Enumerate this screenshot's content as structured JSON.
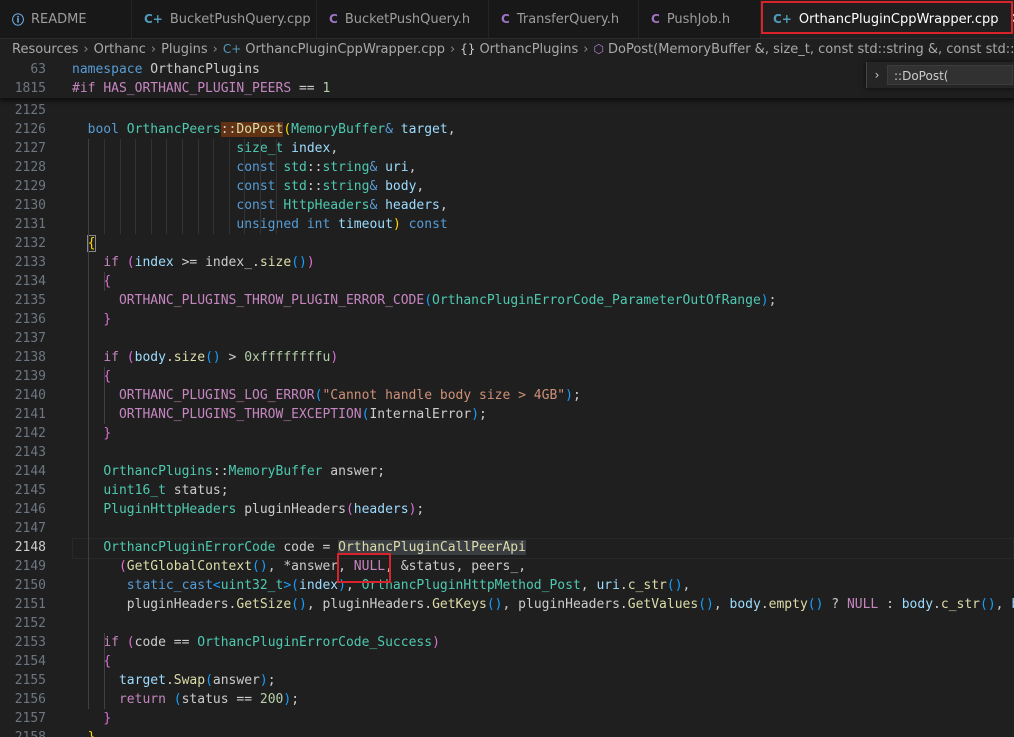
{
  "tabs": [
    {
      "icon": "info-icon",
      "glyph": "ⓘ",
      "label": "README",
      "kind": "info"
    },
    {
      "icon": "cpp-file-icon",
      "glyph": "C+",
      "label": "BucketPushQuery.cpp",
      "kind": "cpp"
    },
    {
      "icon": "c-header-icon",
      "glyph": "C",
      "label": "BucketPushQuery.h",
      "kind": "h"
    },
    {
      "icon": "c-header-icon",
      "glyph": "C",
      "label": "TransferQuery.h",
      "kind": "h"
    },
    {
      "icon": "c-header-icon",
      "glyph": "C",
      "label": "PushJob.h",
      "kind": "h"
    },
    {
      "icon": "cpp-file-icon",
      "glyph": "C+",
      "label": "OrthancPluginCppWrapper.cpp",
      "kind": "cpp",
      "active": true,
      "close": "✕"
    }
  ],
  "breadcrumb": {
    "items": [
      "Resources",
      "Orthanc",
      "Plugins",
      "OrthancPluginCppWrapper.cpp",
      "OrthancPlugins",
      "DoPost(MemoryBuffer &, size_t, const std::string &, const std::string &, const H"
    ],
    "sep": "›",
    "file_glyph": "C+",
    "ns_glyph": "{}",
    "method_glyph": "⬡"
  },
  "find": {
    "chevron": "›",
    "value": "::DoPost("
  },
  "sticky": [
    {
      "num": "63",
      "tokens": [
        [
          "kw",
          "namespace"
        ],
        [
          "",
          " OrthancPlugins"
        ]
      ]
    },
    {
      "num": "1815",
      "tokens": [
        [
          "pp",
          "#if"
        ],
        [
          "",
          " "
        ],
        [
          "mac",
          "HAS_ORTHANC_PLUGIN_PEERS"
        ],
        [
          "",
          " == "
        ],
        [
          "nu",
          "1"
        ]
      ]
    }
  ],
  "lines": [
    {
      "num": "2125",
      "tokens": []
    },
    {
      "num": "2126",
      "tokens": [
        [
          "",
          "  "
        ],
        [
          "kw",
          "bool"
        ],
        [
          "",
          " "
        ],
        [
          "cl",
          "OrthancPeers"
        ],
        [
          "hl",
          "::"
        ],
        [
          "hlfn",
          "DoPost"
        ],
        [
          "b1",
          "("
        ],
        [
          "ty",
          "MemoryBuffer"
        ],
        [
          "kw",
          "&"
        ],
        [
          "",
          " "
        ],
        [
          "pa",
          "target"
        ],
        [
          "",
          ","
        ]
      ]
    },
    {
      "num": "2127",
      "tokens": [
        [
          "",
          "                     "
        ],
        [
          "ty",
          "size_t"
        ],
        [
          "",
          " "
        ],
        [
          "pa",
          "index"
        ],
        [
          "",
          ","
        ]
      ]
    },
    {
      "num": "2128",
      "tokens": [
        [
          "",
          "                     "
        ],
        [
          "kw",
          "const"
        ],
        [
          "",
          " "
        ],
        [
          "ty",
          "std"
        ],
        [
          "",
          "::"
        ],
        [
          "ty",
          "string"
        ],
        [
          "kw",
          "&"
        ],
        [
          "",
          " "
        ],
        [
          "pa",
          "uri"
        ],
        [
          "",
          ","
        ]
      ]
    },
    {
      "num": "2129",
      "tokens": [
        [
          "",
          "                     "
        ],
        [
          "kw",
          "const"
        ],
        [
          "",
          " "
        ],
        [
          "ty",
          "std"
        ],
        [
          "",
          "::"
        ],
        [
          "ty",
          "string"
        ],
        [
          "kw",
          "&"
        ],
        [
          "",
          " "
        ],
        [
          "pa",
          "body"
        ],
        [
          "",
          ","
        ]
      ]
    },
    {
      "num": "2130",
      "tokens": [
        [
          "",
          "                     "
        ],
        [
          "kw",
          "const"
        ],
        [
          "",
          " "
        ],
        [
          "ty",
          "HttpHeaders"
        ],
        [
          "kw",
          "&"
        ],
        [
          "",
          " "
        ],
        [
          "pa",
          "headers"
        ],
        [
          "",
          ","
        ]
      ]
    },
    {
      "num": "2131",
      "tokens": [
        [
          "",
          "                     "
        ],
        [
          "kw",
          "unsigned"
        ],
        [
          "",
          " "
        ],
        [
          "kw",
          "int"
        ],
        [
          "",
          " "
        ],
        [
          "pa",
          "timeout"
        ],
        [
          "b1",
          ")"
        ],
        [
          "",
          " "
        ],
        [
          "kw",
          "const"
        ]
      ]
    },
    {
      "num": "2132",
      "tokens": [
        [
          "",
          "  "
        ],
        [
          "b1hl",
          "{"
        ]
      ]
    },
    {
      "num": "2133",
      "tokens": [
        [
          "",
          "    "
        ],
        [
          "pp",
          "if"
        ],
        [
          "",
          " "
        ],
        [
          "b2",
          "("
        ],
        [
          "pa",
          "index"
        ],
        [
          "",
          " >= "
        ],
        [
          "",
          "index_"
        ],
        [
          "",
          "."
        ],
        [
          "fn",
          "size"
        ],
        [
          "b3",
          "()"
        ],
        [
          "b2",
          ")"
        ]
      ]
    },
    {
      "num": "2134",
      "tokens": [
        [
          "",
          "    "
        ],
        [
          "b2",
          "{"
        ]
      ]
    },
    {
      "num": "2135",
      "tokens": [
        [
          "",
          "      "
        ],
        [
          "mac",
          "ORTHANC_PLUGINS_THROW_PLUGIN_ERROR_CODE"
        ],
        [
          "b3",
          "("
        ],
        [
          "ty",
          "OrthancPluginErrorCode_ParameterOutOfRange"
        ],
        [
          "b3",
          ")"
        ],
        [
          "",
          ";"
        ]
      ]
    },
    {
      "num": "2136",
      "tokens": [
        [
          "",
          "    "
        ],
        [
          "b2",
          "}"
        ]
      ]
    },
    {
      "num": "2137",
      "tokens": []
    },
    {
      "num": "2138",
      "tokens": [
        [
          "",
          "    "
        ],
        [
          "pp",
          "if"
        ],
        [
          "",
          " "
        ],
        [
          "b2",
          "("
        ],
        [
          "pa",
          "body"
        ],
        [
          "",
          "."
        ],
        [
          "fn",
          "size"
        ],
        [
          "b3",
          "()"
        ],
        [
          "",
          " > "
        ],
        [
          "nu",
          "0xffffffffu"
        ],
        [
          "b2",
          ")"
        ]
      ]
    },
    {
      "num": "2139",
      "tokens": [
        [
          "",
          "    "
        ],
        [
          "b2",
          "{"
        ]
      ]
    },
    {
      "num": "2140",
      "tokens": [
        [
          "",
          "      "
        ],
        [
          "mac",
          "ORTHANC_PLUGINS_LOG_ERROR"
        ],
        [
          "b3",
          "("
        ],
        [
          "st",
          "\"Cannot handle body size > 4GB\""
        ],
        [
          "b3",
          ")"
        ],
        [
          "",
          ";"
        ]
      ]
    },
    {
      "num": "2141",
      "tokens": [
        [
          "",
          "      "
        ],
        [
          "mac",
          "ORTHANC_PLUGINS_THROW_EXCEPTION"
        ],
        [
          "b3",
          "("
        ],
        [
          "",
          "InternalError"
        ],
        [
          "b3",
          ")"
        ],
        [
          "",
          ";"
        ]
      ]
    },
    {
      "num": "2142",
      "tokens": [
        [
          "",
          "    "
        ],
        [
          "b2",
          "}"
        ]
      ]
    },
    {
      "num": "2143",
      "tokens": []
    },
    {
      "num": "2144",
      "tokens": [
        [
          "",
          "    "
        ],
        [
          "ty",
          "OrthancPlugins"
        ],
        [
          "",
          "::"
        ],
        [
          "ty",
          "MemoryBuffer"
        ],
        [
          "",
          " "
        ],
        [
          "",
          "answer"
        ],
        [
          "",
          ";"
        ]
      ]
    },
    {
      "num": "2145",
      "tokens": [
        [
          "",
          "    "
        ],
        [
          "ty",
          "uint16_t"
        ],
        [
          "",
          " "
        ],
        [
          "",
          "status"
        ],
        [
          "",
          ";"
        ]
      ]
    },
    {
      "num": "2146",
      "tokens": [
        [
          "",
          "    "
        ],
        [
          "ty",
          "PluginHttpHeaders"
        ],
        [
          "",
          " "
        ],
        [
          "",
          "pluginHeaders"
        ],
        [
          "b2",
          "("
        ],
        [
          "pa",
          "headers"
        ],
        [
          "b2",
          ")"
        ],
        [
          "",
          ";"
        ]
      ]
    },
    {
      "num": "2147",
      "tokens": []
    },
    {
      "num": "2148",
      "tokens": [
        [
          "",
          "    "
        ],
        [
          "ty",
          "OrthancPluginErrorCode"
        ],
        [
          "",
          " "
        ],
        [
          "",
          "code"
        ],
        [
          "",
          " = "
        ],
        [
          "hl2fn",
          "OrthancPluginCallPeerApi"
        ]
      ],
      "cursor": true
    },
    {
      "num": "2149",
      "tokens": [
        [
          "",
          "      "
        ],
        [
          "b2",
          "("
        ],
        [
          "fn",
          "GetGlobalContext"
        ],
        [
          "b3",
          "()"
        ],
        [
          "",
          ", *"
        ],
        [
          "",
          "answer"
        ],
        [
          "",
          ", "
        ],
        [
          "nullk",
          "NULL"
        ],
        [
          "",
          ", &"
        ],
        [
          "",
          "status"
        ],
        [
          "",
          ", "
        ],
        [
          "",
          "peers_"
        ],
        [
          "",
          ","
        ]
      ]
    },
    {
      "num": "2150",
      "tokens": [
        [
          "",
          "       "
        ],
        [
          "kw",
          "static_cast"
        ],
        [
          "b3",
          "<"
        ],
        [
          "ty",
          "uint32_t"
        ],
        [
          "b3",
          ">"
        ],
        [
          "b3",
          "("
        ],
        [
          "pa",
          "index"
        ],
        [
          "b3",
          ")"
        ],
        [
          "",
          ", "
        ],
        [
          "ty",
          "OrthancPluginHttpMethod_Post"
        ],
        [
          "",
          ", "
        ],
        [
          "pa",
          "uri"
        ],
        [
          "",
          "."
        ],
        [
          "fn",
          "c_str"
        ],
        [
          "b3",
          "()"
        ],
        [
          "",
          ","
        ]
      ]
    },
    {
      "num": "2151",
      "tokens": [
        [
          "",
          "       "
        ],
        [
          "",
          "pluginHeaders"
        ],
        [
          "",
          "."
        ],
        [
          "fn",
          "GetSize"
        ],
        [
          "b3",
          "()"
        ],
        [
          "",
          ", "
        ],
        [
          "",
          "pluginHeaders"
        ],
        [
          "",
          "."
        ],
        [
          "fn",
          "GetKeys"
        ],
        [
          "b3",
          "()"
        ],
        [
          "",
          ", "
        ],
        [
          "",
          "pluginHeaders"
        ],
        [
          "",
          "."
        ],
        [
          "fn",
          "GetValues"
        ],
        [
          "b3",
          "()"
        ],
        [
          "",
          ", "
        ],
        [
          "pa",
          "body"
        ],
        [
          "",
          "."
        ],
        [
          "fn",
          "empty"
        ],
        [
          "b3",
          "()"
        ],
        [
          "",
          " ? "
        ],
        [
          "nullk",
          "NULL"
        ],
        [
          "",
          " : "
        ],
        [
          "pa",
          "body"
        ],
        [
          "",
          "."
        ],
        [
          "fn",
          "c_str"
        ],
        [
          "b3",
          "()"
        ],
        [
          "",
          ", "
        ],
        [
          "pa",
          "bod"
        ]
      ]
    },
    {
      "num": "2152",
      "tokens": []
    },
    {
      "num": "2153",
      "tokens": [
        [
          "",
          "    "
        ],
        [
          "pp",
          "if"
        ],
        [
          "",
          " "
        ],
        [
          "b2",
          "("
        ],
        [
          "",
          "code"
        ],
        [
          "",
          " == "
        ],
        [
          "ty",
          "OrthancPluginErrorCode_Success"
        ],
        [
          "b2",
          ")"
        ]
      ]
    },
    {
      "num": "2154",
      "tokens": [
        [
          "",
          "    "
        ],
        [
          "b2",
          "{"
        ]
      ]
    },
    {
      "num": "2155",
      "tokens": [
        [
          "",
          "      "
        ],
        [
          "pa",
          "target"
        ],
        [
          "",
          "."
        ],
        [
          "fn",
          "Swap"
        ],
        [
          "b3",
          "("
        ],
        [
          "",
          "answer"
        ],
        [
          "b3",
          ")"
        ],
        [
          "",
          ";"
        ]
      ]
    },
    {
      "num": "2156",
      "tokens": [
        [
          "",
          "      "
        ],
        [
          "pp",
          "return"
        ],
        [
          "",
          " "
        ],
        [
          "b3",
          "("
        ],
        [
          "",
          "status"
        ],
        [
          "",
          " == "
        ],
        [
          "nu",
          "200"
        ],
        [
          "b3",
          ")"
        ],
        [
          "",
          ";"
        ]
      ]
    },
    {
      "num": "2157",
      "tokens": [
        [
          "",
          "    "
        ],
        [
          "b2",
          "}"
        ]
      ]
    },
    {
      "num": "2158",
      "tokens": [
        [
          "",
          "  "
        ],
        [
          "b1",
          "}"
        ]
      ]
    }
  ]
}
